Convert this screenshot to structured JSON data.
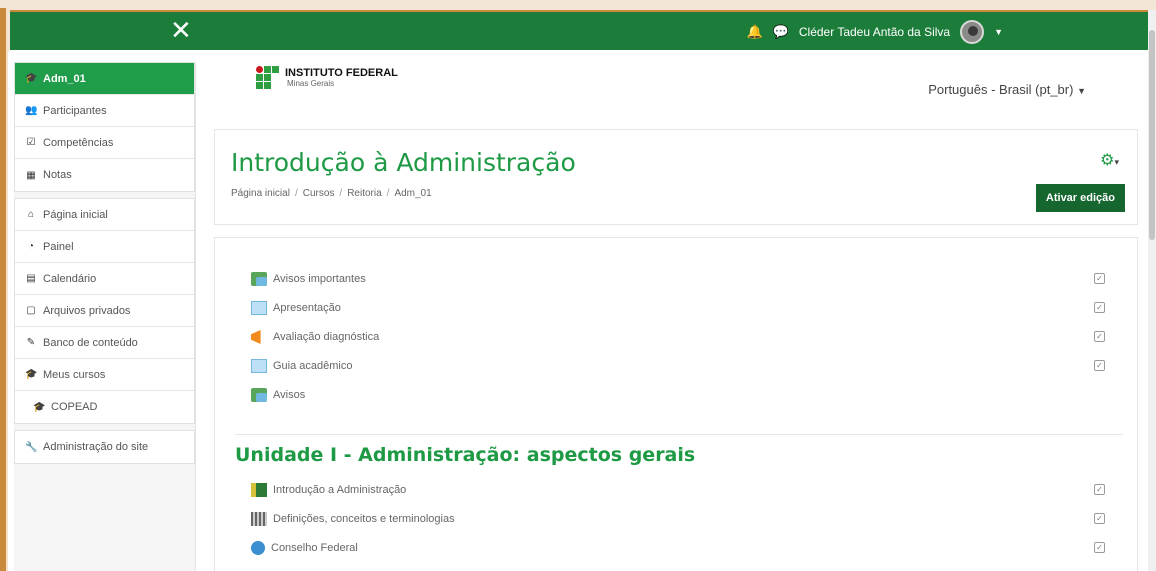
{
  "navbar": {
    "user_name": "Cléder Tadeu Antão da Silva",
    "close_glyph": "✕",
    "bell_icon": "bell-icon",
    "chat_icon": "chat-icon",
    "bg_color": "#1c7d3a"
  },
  "sidebar": {
    "groups": [
      [
        {
          "label": "Adm_01",
          "icon": "graduation-cap-icon",
          "active": true
        },
        {
          "label": "Participantes",
          "icon": "users-icon"
        },
        {
          "label": "Competências",
          "icon": "check-square-icon"
        },
        {
          "label": "Notas",
          "icon": "table-icon"
        }
      ],
      [
        {
          "label": "Página inicial",
          "icon": "home-icon"
        },
        {
          "label": "Painel",
          "icon": "dashboard-icon"
        },
        {
          "label": "Calendário",
          "icon": "calendar-icon"
        },
        {
          "label": "Arquivos privados",
          "icon": "file-icon"
        },
        {
          "label": "Banco de conteúdo",
          "icon": "brush-icon"
        },
        {
          "label": "Meus cursos",
          "icon": "graduation-cap-icon"
        },
        {
          "label": "COPEAD",
          "icon": "graduation-cap-icon",
          "indent": true
        }
      ],
      [
        {
          "label": "Administração do site",
          "icon": "wrench-icon"
        }
      ]
    ]
  },
  "header": {
    "logo_title": "INSTITUTO FEDERAL",
    "logo_sub": "Minas Gerais",
    "language": "Português - Brasil (pt_br)",
    "page_title": "Introdução à Administração",
    "breadcrumb": [
      "Página inicial",
      "Cursos",
      "Reitoria",
      "Adm_01"
    ],
    "edit_button": "Ativar edição",
    "accent_color": "#1e9a45"
  },
  "activities": [
    {
      "label": "Avisos importantes",
      "icon": "forum-icon",
      "checkbox": true
    },
    {
      "label": "Apresentação",
      "icon": "page-icon",
      "checkbox": true
    },
    {
      "label": "Avaliação diagnóstica",
      "icon": "feedback-icon",
      "checkbox": true
    },
    {
      "label": "Guia acadêmico",
      "icon": "page-icon",
      "checkbox": true
    },
    {
      "label": "Avisos",
      "icon": "forum-icon",
      "checkbox": false
    }
  ],
  "section": {
    "title": "Unidade I - Administração: aspectos gerais",
    "items": [
      {
        "label": "Introdução a Administração",
        "icon": "book-icon",
        "checkbox": true
      },
      {
        "label": "Definições, conceitos e terminologias",
        "icon": "glossary-icon",
        "checkbox": true
      },
      {
        "label": "Conselho Federal",
        "icon": "url-icon",
        "checkbox": true
      }
    ]
  }
}
